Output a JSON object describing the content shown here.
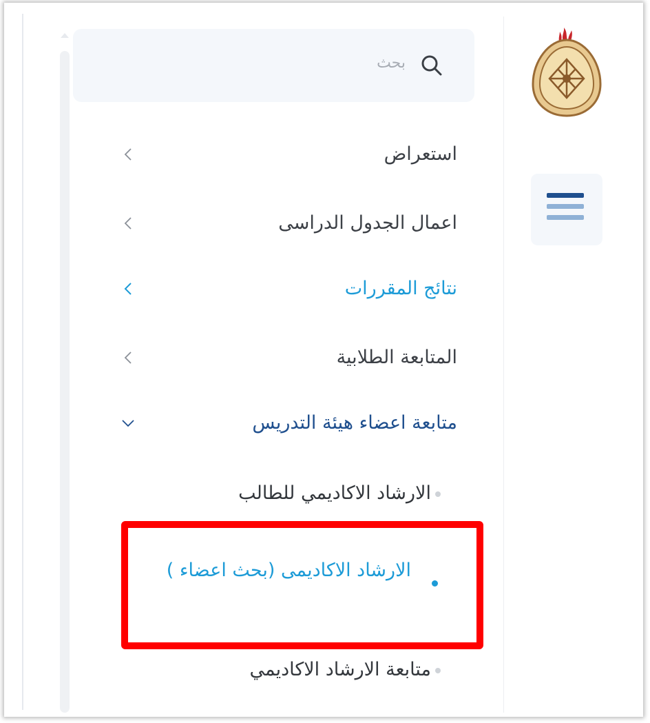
{
  "search": {
    "placeholder": "بحث"
  },
  "menu_toggle": {
    "colors": {
      "top": "#1f4f8e",
      "middle": "#8fb1d6",
      "bottom": "#8fb1d6"
    }
  },
  "nav": {
    "items": [
      {
        "label": "استعراض",
        "state": "collapsed"
      },
      {
        "label": "اعمال الجدول الدراسى",
        "state": "collapsed"
      },
      {
        "label": "نتائج المقررات",
        "state": "active"
      },
      {
        "label": "المتابعة الطلابية",
        "state": "collapsed"
      },
      {
        "label": "متابعة اعضاء هيئة التدريس",
        "state": "expanded"
      }
    ],
    "subitems": [
      {
        "label": "الارشاد الاكاديمي للطالب",
        "state": "normal"
      },
      {
        "label": "الارشاد الاكاديمى (بحث اعضاء )",
        "state": "highlighted"
      },
      {
        "label": "متابعة الارشاد الاكاديمي",
        "state": "normal"
      }
    ]
  },
  "colors": {
    "accent": "#1c9bd7",
    "expanded": "#1f4f8e",
    "highlight_box": "#ff0000",
    "text": "#3c4046"
  }
}
